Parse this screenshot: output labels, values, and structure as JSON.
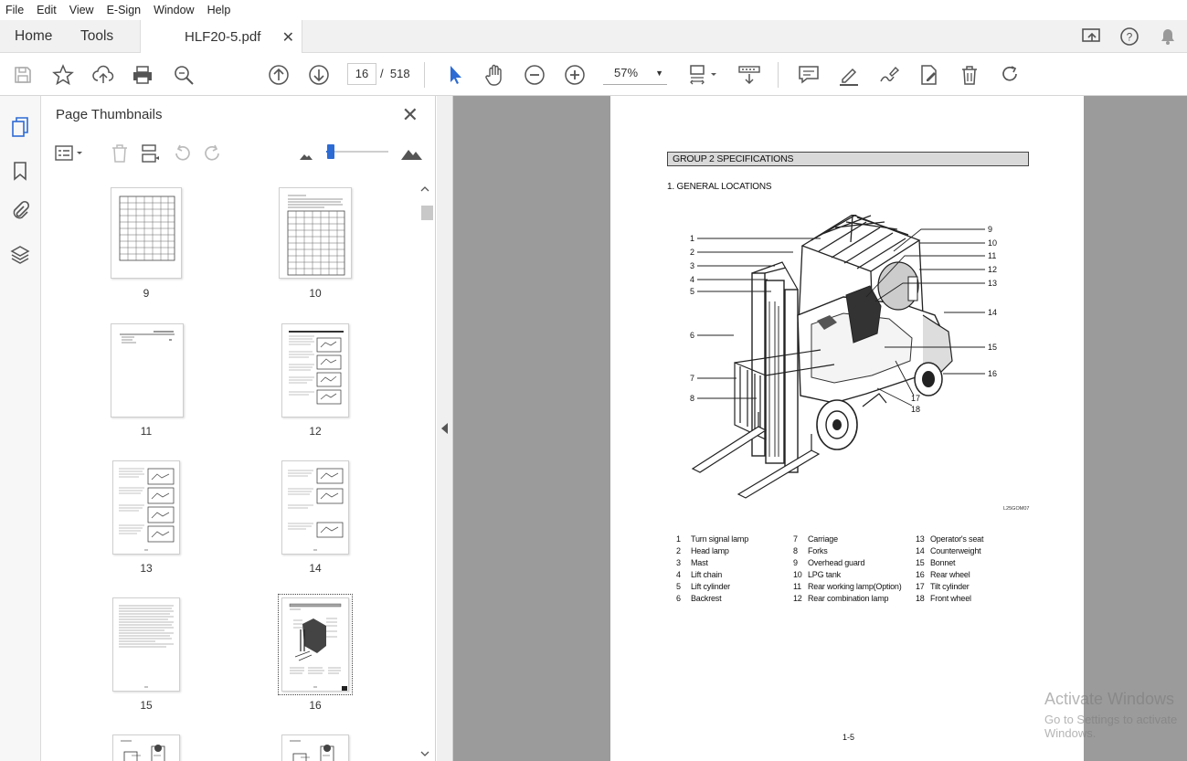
{
  "menu": [
    "File",
    "Edit",
    "View",
    "E-Sign",
    "Window",
    "Help"
  ],
  "tabs": {
    "home": "Home",
    "tools": "Tools",
    "document": "HLF20-5.pdf"
  },
  "toolbar": {
    "page_current": "16",
    "page_sep": "/",
    "page_total": "518",
    "zoom": "57%"
  },
  "panel": {
    "title": "Page Thumbnails",
    "thumbnails": [
      {
        "label": "9"
      },
      {
        "label": "10"
      },
      {
        "label": "11"
      },
      {
        "label": "12"
      },
      {
        "label": "13"
      },
      {
        "label": "14"
      },
      {
        "label": "15"
      },
      {
        "label": "16"
      }
    ]
  },
  "document_page": {
    "group_heading": "GROUP 2  SPECIFICATIONS",
    "section_heading": "1. GENERAL LOCATIONS",
    "figure_code": "L25GOM07",
    "callouts_left": [
      "1",
      "2",
      "3",
      "4",
      "5",
      "6",
      "7",
      "8"
    ],
    "callouts_right": [
      "9",
      "10",
      "11",
      "12",
      "13",
      "14",
      "15",
      "16"
    ],
    "callouts_bottom": [
      "17",
      "18"
    ],
    "legend": [
      {
        "num": "1",
        "label": "Turn signal lamp"
      },
      {
        "num": "2",
        "label": "Head lamp"
      },
      {
        "num": "3",
        "label": "Mast"
      },
      {
        "num": "4",
        "label": "Lift chain"
      },
      {
        "num": "5",
        "label": "Lift cylinder"
      },
      {
        "num": "6",
        "label": "Backrest"
      },
      {
        "num": "7",
        "label": "Carriage"
      },
      {
        "num": "8",
        "label": "Forks"
      },
      {
        "num": "9",
        "label": "Overhead guard"
      },
      {
        "num": "10",
        "label": "LPG tank"
      },
      {
        "num": "11",
        "label": "Rear working lamp(Option)"
      },
      {
        "num": "12",
        "label": "Rear combination lamp"
      },
      {
        "num": "13",
        "label": "Operator's seat"
      },
      {
        "num": "14",
        "label": "Counterweight"
      },
      {
        "num": "15",
        "label": "Bonnet"
      },
      {
        "num": "16",
        "label": "Rear wheel"
      },
      {
        "num": "17",
        "label": "Tilt cylinder"
      },
      {
        "num": "18",
        "label": "Front wheel"
      }
    ],
    "page_number": "1-5"
  },
  "watermark": {
    "line1": "Activate Windows",
    "line2": "Go to Settings to activate Windows."
  },
  "colors": {
    "accent": "#2d6bd4",
    "viewport_bg": "#9b9b9b",
    "heading_fill": "#d9d9d9"
  }
}
